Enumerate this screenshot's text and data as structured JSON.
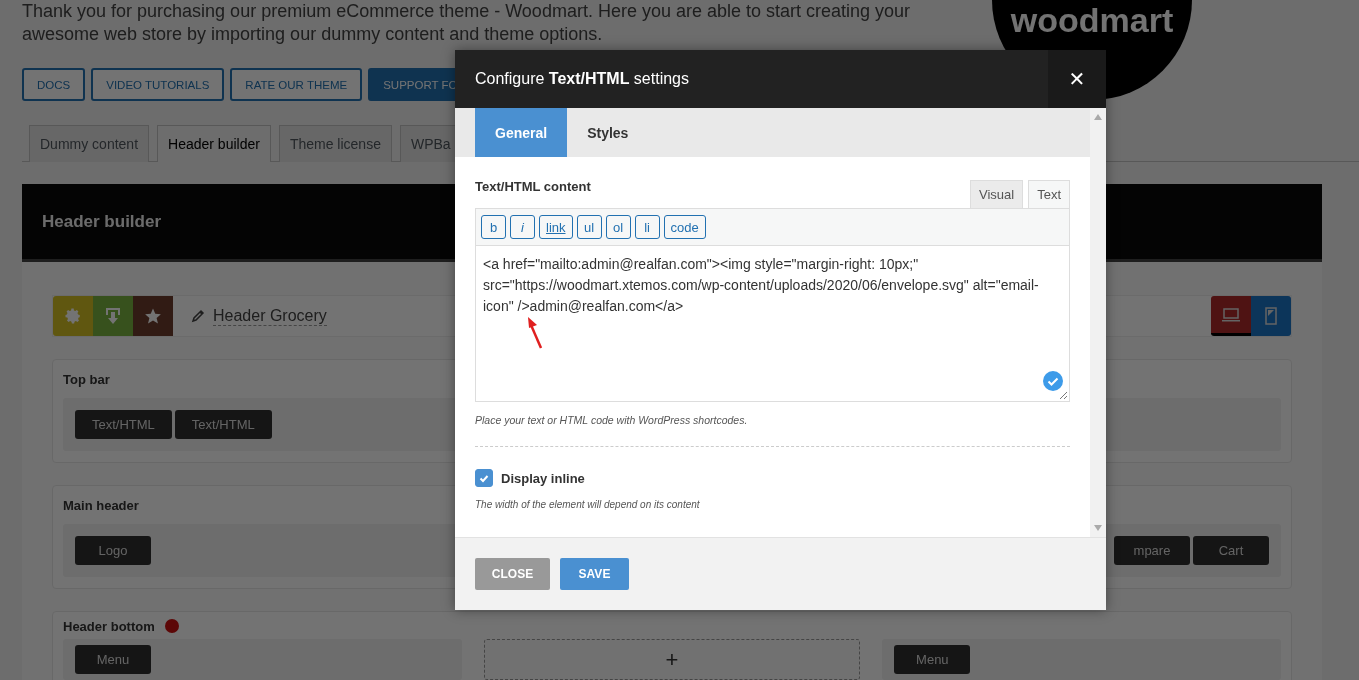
{
  "intro": {
    "lines": [
      "Thank you for purchasing our premium eCommerce theme - Woodmart. Here you are able to start creating your",
      "awesome web store by importing our dummy content and theme options."
    ]
  },
  "logo": {
    "text": "woodmart"
  },
  "link_buttons": [
    {
      "label": "DOCS",
      "kind": "outline"
    },
    {
      "label": "VIDEO TUTORIALS",
      "kind": "outline"
    },
    {
      "label": "RATE OUR THEME",
      "kind": "outline"
    },
    {
      "label": "SUPPORT FO",
      "kind": "filled"
    }
  ],
  "tabs": [
    {
      "label": "Dummy content",
      "selected": false
    },
    {
      "label": "Header builder",
      "selected": true
    },
    {
      "label": "Theme license",
      "selected": false
    },
    {
      "label": "WPBa",
      "selected": false
    }
  ],
  "builder": {
    "title": "Header builder",
    "header_name": "Header Grocery",
    "devices": [
      {
        "kind": "desktop",
        "selected": true
      },
      {
        "kind": "mobile",
        "selected": false
      }
    ],
    "rows": [
      {
        "kind": "simple",
        "title": "Top bar",
        "items": [
          "Text/HTML",
          "Text/HTML"
        ],
        "right_items": []
      },
      {
        "kind": "simple",
        "title": "Main header",
        "items": [
          "Logo"
        ],
        "right_items": [
          "mpare",
          "Cart"
        ]
      },
      {
        "kind": "columns",
        "title": "Header bottom",
        "alert": true,
        "columns": [
          {
            "kind": "items",
            "items": [
              "Menu"
            ]
          },
          {
            "kind": "add",
            "symbol": "+"
          },
          {
            "kind": "items",
            "items": [
              "Menu"
            ]
          }
        ]
      }
    ]
  },
  "modal": {
    "title": "Configure **Text/HTML** settings",
    "close": "✕",
    "tabs": [
      {
        "label": "General",
        "selected": true
      },
      {
        "label": "Styles",
        "selected": false
      }
    ],
    "content_label": "Text/HTML content",
    "editor_modes": [
      {
        "label": "Visual",
        "selected": false
      },
      {
        "label": "Text",
        "selected": true
      }
    ],
    "quicktags": [
      {
        "label": "b",
        "kind": "bold"
      },
      {
        "label": "i",
        "kind": "italic"
      },
      {
        "label": "link",
        "kind": "link"
      },
      {
        "label": "ul",
        "kind": "plain"
      },
      {
        "label": "ol",
        "kind": "plain"
      },
      {
        "label": "li",
        "kind": "plain"
      },
      {
        "label": "code",
        "kind": "plain"
      }
    ],
    "code": "<a href=\"mailto:admin@realfan.com\"><img style=\"margin-right: 10px;\" src=\"https://woodmart.xtemos.com/wp-content/uploads/2020/06/envelope.svg\" alt=\"email-icon\" />admin@realfan.com</a>",
    "hint": "Place your text or HTML code with WordPress shortcodes.",
    "display_inline": {
      "label": "Display inline",
      "checked": true,
      "description": "The width of the element will depend on its content"
    },
    "buttons": [
      {
        "label": "CLOSE",
        "kind": "secondary"
      },
      {
        "label": "SAVE",
        "kind": "primary"
      }
    ]
  }
}
